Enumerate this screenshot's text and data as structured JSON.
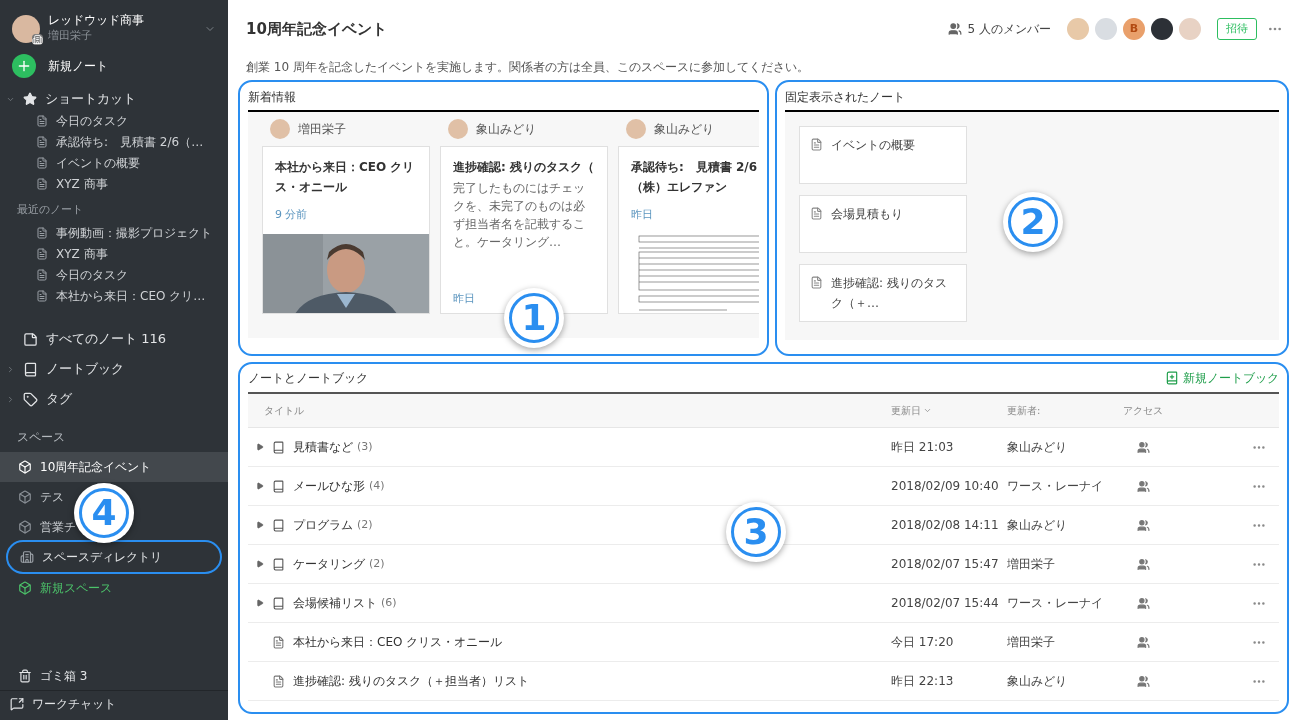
{
  "sidebar": {
    "account": {
      "name": "レッドウッド商事",
      "user": "増田栄子"
    },
    "new_note": "新規ノート",
    "shortcuts": {
      "label": "ショートカット",
      "expanded": true,
      "items": [
        "今日のタスク",
        "承認待ち:　見積書 2/6（…",
        "イベントの概要",
        "XYZ 商事"
      ]
    },
    "recent": {
      "label": "最近のノート",
      "items": [
        "事例動画：撮影プロジェクト",
        "XYZ 商事",
        "今日のタスク",
        "本社から来日：CEO クリ…"
      ]
    },
    "nav": [
      {
        "kind": "notes",
        "label": "すべてのノート 116"
      },
      {
        "kind": "notebooks",
        "label": "ノートブック",
        "expanded": false
      },
      {
        "kind": "tags",
        "label": "タグ",
        "expanded": false
      }
    ],
    "spaces": {
      "label": "スペース",
      "callout": "4",
      "items": [
        {
          "label": "10周年記念イベント",
          "selected": true
        },
        {
          "label": "テス",
          "selected": false
        },
        {
          "label": "営業チ",
          "selected": false
        }
      ]
    },
    "directory": "スペースディレクトリ",
    "new_space": "新規スペース",
    "trash": "ゴミ箱 3",
    "work_chat": "ワークチャット"
  },
  "header": {
    "title": "10周年記念イベント",
    "members_label": "5 人のメンバー",
    "members": [
      {
        "color": "#e8c9a8"
      },
      {
        "color": "#d9dde2"
      },
      {
        "color": "#e9a06b",
        "initial": "B"
      },
      {
        "color": "#2c3036"
      },
      {
        "color": "#e8d2c4"
      }
    ],
    "invite": "招待",
    "description": "創業 10 周年を記念したイベントを実施します。関係者の方は全員、このスペースに参加してください。"
  },
  "recent": {
    "title": "新着情報",
    "callout": "1",
    "cards": [
      {
        "author": "増田栄子",
        "title": "本社から来日：CEO クリス・オニール",
        "time": "9 分前"
      },
      {
        "kind": "text",
        "author": "象山みどり",
        "title": "進捗確認: 残りのタスク（",
        "body": "完了したものにはチェックを、未完了のものは必ず担当者名を記載すること。ケータリング…",
        "time": "昨日"
      },
      {
        "kind": "document",
        "author": "象山みどり",
        "title": "承認待ち:　見積書 2/6（株）エレファン",
        "time": "昨日"
      }
    ]
  },
  "pinned": {
    "title": "固定表示されたノート",
    "callout": "2",
    "notes": [
      "イベントの概要",
      "会場見積もり",
      "進捗確認: 残りのタスク（＋…"
    ]
  },
  "notebooks": {
    "title": "ノートとノートブック",
    "callout": "3",
    "new_button": "新規ノートブック",
    "columns": [
      {
        "label": "タイトル",
        "sorted": false
      },
      {
        "label": "更新日",
        "sorted": true
      },
      {
        "label": "更新者:",
        "sorted": false
      },
      {
        "label": "アクセス",
        "sorted": false
      }
    ],
    "rows": [
      {
        "kind": "notebook",
        "title": "見積書など",
        "count": "(3)",
        "updated": "昨日 21:03",
        "by": "象山みどり"
      },
      {
        "kind": "notebook",
        "title": "メールひな形",
        "count": "(4)",
        "updated": "2018/02/09 10:40",
        "by": "ワース・レーナイ"
      },
      {
        "kind": "notebook",
        "title": "プログラム",
        "count": "(2)",
        "updated": "2018/02/08 14:11",
        "by": "象山みどり"
      },
      {
        "kind": "notebook",
        "title": "ケータリング",
        "count": "(2)",
        "updated": "2018/02/07 15:47",
        "by": "増田栄子"
      },
      {
        "kind": "notebook",
        "title": "会場候補リスト",
        "count": "(6)",
        "updated": "2018/02/07 15:44",
        "by": "ワース・レーナイ"
      },
      {
        "kind": "note",
        "title": "本社から来日：CEO クリス・オニール",
        "updated": "今日 17:20",
        "by": "増田栄子"
      },
      {
        "kind": "note",
        "title": "進捗確認: 残りのタスク（＋担当者）リスト",
        "updated": "昨日 22:13",
        "by": "象山みどり"
      }
    ]
  }
}
